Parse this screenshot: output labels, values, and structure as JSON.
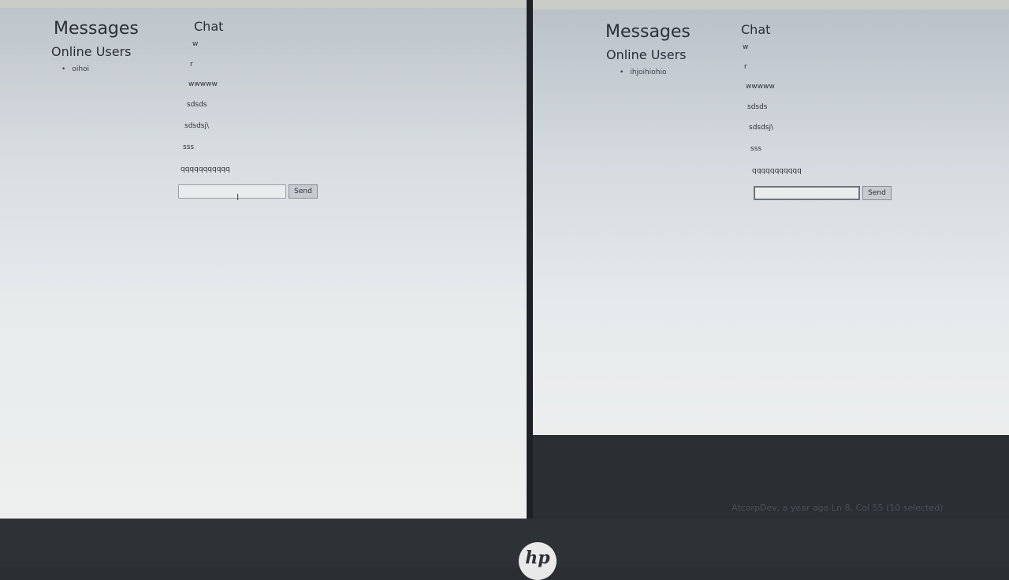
{
  "left": {
    "title": "Messages",
    "online_heading": "Online Users",
    "users": [
      "oihoi"
    ],
    "chat_heading": "Chat",
    "messages": [
      "w",
      "r",
      "wwwww",
      "sdsds",
      "sdsdsj\\",
      "sss",
      "qqqqqqqqqqq"
    ],
    "input_value": "",
    "send_label": "Send"
  },
  "right": {
    "title": "Messages",
    "online_heading": "Online Users",
    "users": [
      "ihjoihiohio"
    ],
    "chat_heading": "Chat",
    "messages": [
      "w",
      "r",
      "wwwww",
      "sdsds",
      "sdsdsj\\",
      "sss",
      "qqqqqqqqqqq"
    ],
    "input_value": "",
    "send_label": "Send"
  },
  "status_bar": "AtcorpDev, a year ago   Ln 8, Col 55 (10 selected)",
  "logo": "hp"
}
